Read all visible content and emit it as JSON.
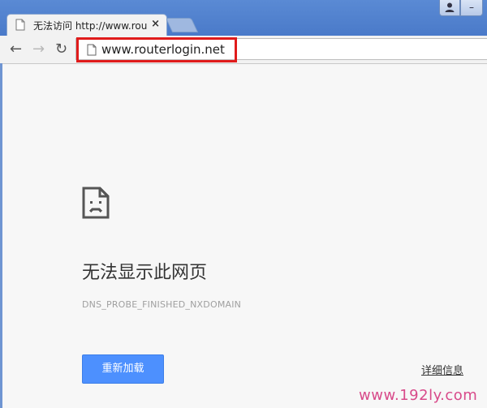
{
  "tab": {
    "title": "无法访问 http://www.rou",
    "close_label": "×"
  },
  "window": {
    "user_icon": "user-icon",
    "minimize_label": "–"
  },
  "toolbar": {
    "back_icon": "back-arrow-icon",
    "forward_icon": "forward-arrow-icon",
    "reload_icon": "reload-icon",
    "back_glyph": "←",
    "forward_glyph": "→",
    "reload_glyph": "↻"
  },
  "omnibox": {
    "url": "www.routerlogin.net"
  },
  "error": {
    "title": "无法显示此网页",
    "code": "DNS_PROBE_FINISHED_NXDOMAIN",
    "reload_button": "重新加载",
    "details_link": "详细信息"
  },
  "watermark": {
    "text": "www.192ly.com"
  },
  "colors": {
    "accent_button": "#4d90fe",
    "highlight_box": "#e01b1b",
    "watermark": "#d84a8a"
  }
}
